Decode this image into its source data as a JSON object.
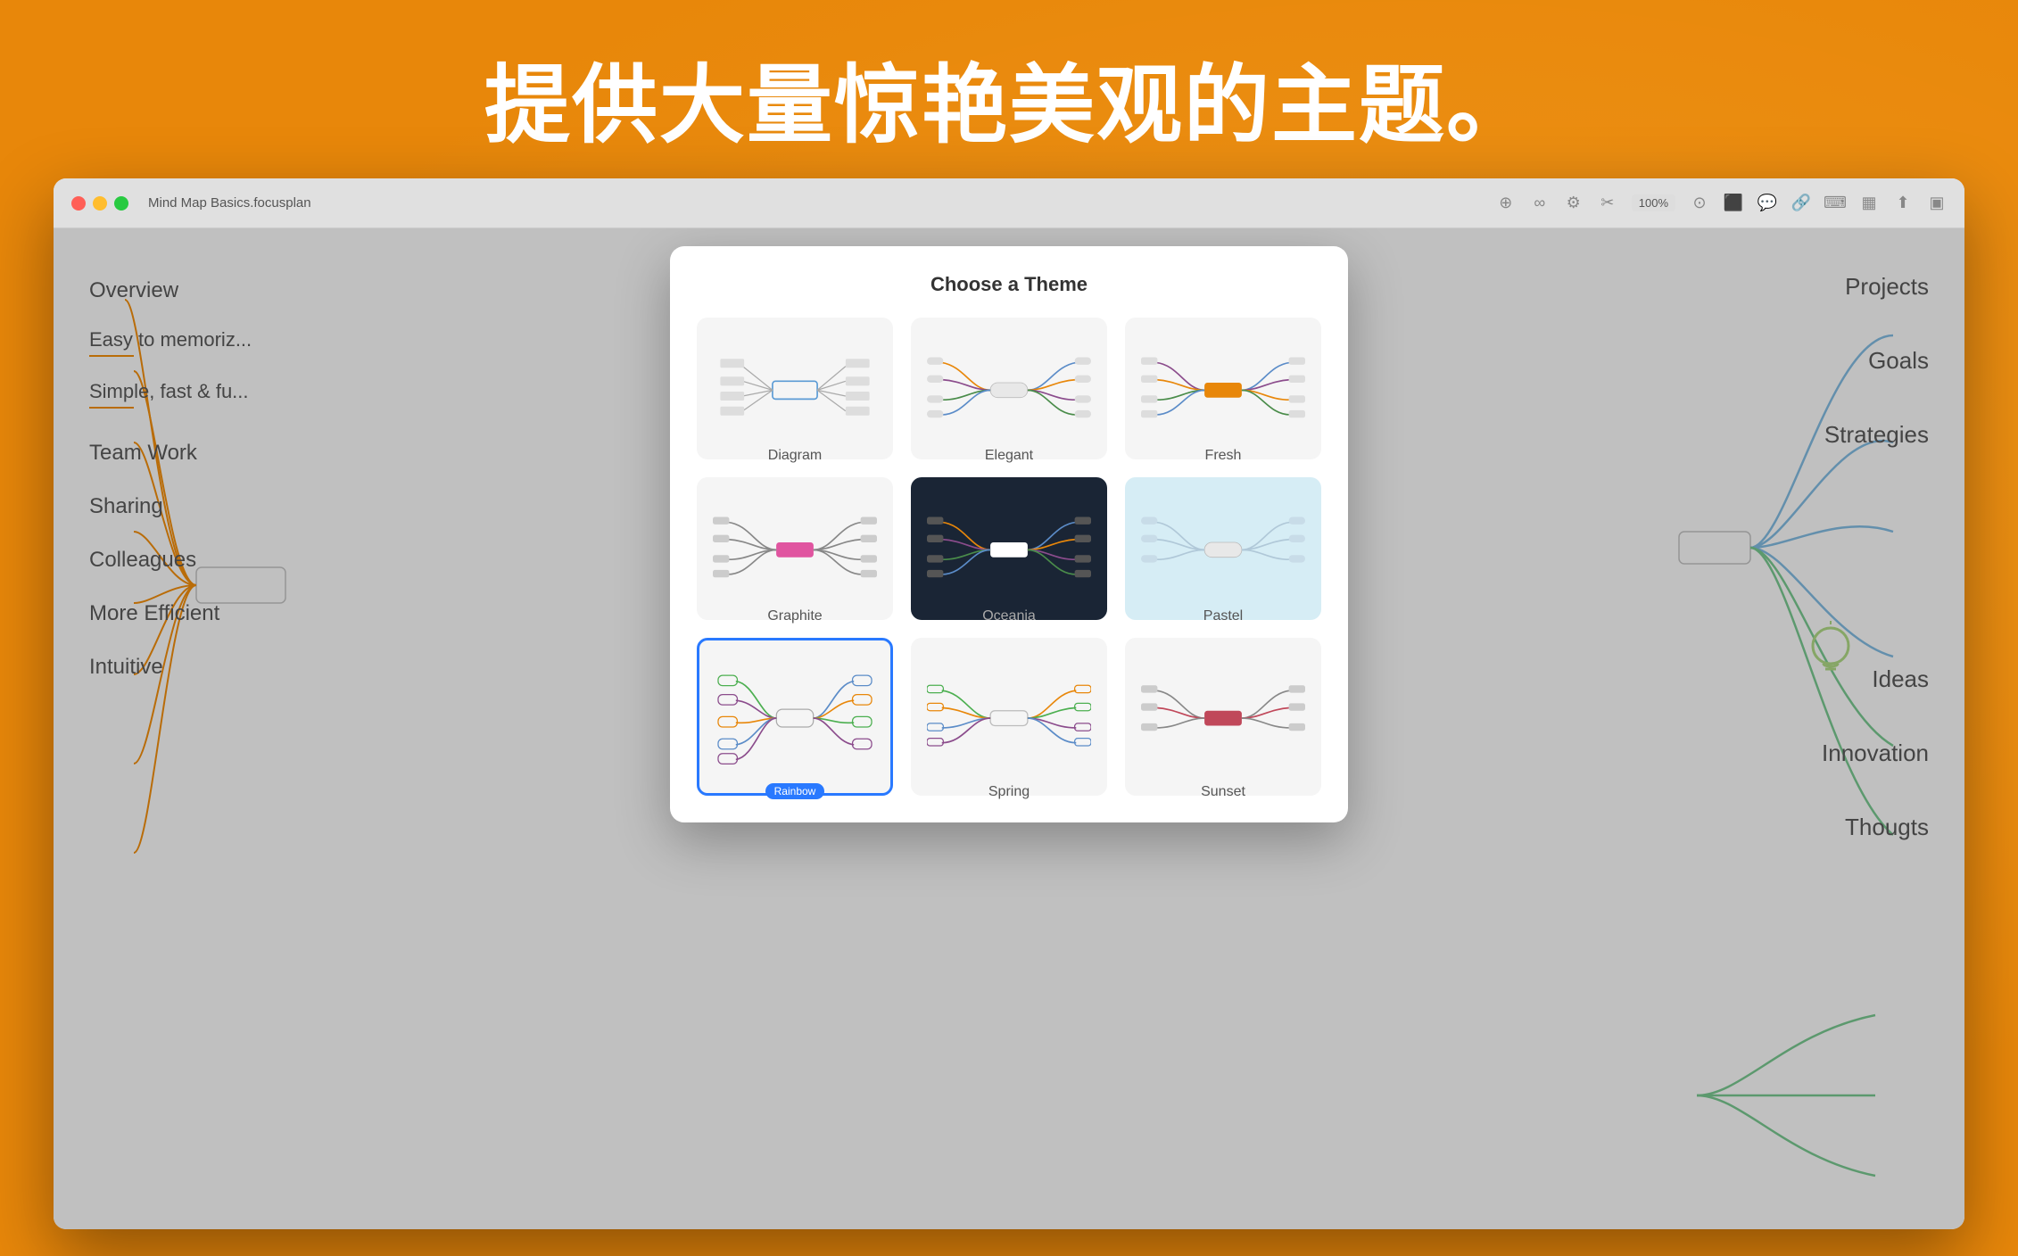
{
  "page": {
    "title": "提供大量惊艳美观的主题。",
    "background_color": "#E8870A"
  },
  "window": {
    "title": "Mind Map Basics.focusplan",
    "zoom": "100%"
  },
  "mindmap_left": {
    "nodes": [
      {
        "label": "Overview",
        "line": true
      },
      {
        "label": "Easy to memoriz...",
        "line": true
      },
      {
        "label": "Simple, fast & fu...",
        "line": true
      },
      {
        "label": "Team Work",
        "line": false
      },
      {
        "label": "Sharing",
        "line": false
      },
      {
        "label": "Colleagues",
        "line": false
      },
      {
        "label": "More Efficient",
        "line": false
      },
      {
        "label": "Intuitive",
        "line": false
      }
    ]
  },
  "mindmap_right": {
    "nodes": [
      "Projects",
      "Goals",
      "Strategies",
      "Ideas",
      "Innovation",
      "Thougts"
    ]
  },
  "modal": {
    "title": "Choose a Theme",
    "themes": [
      {
        "name": "Diagram",
        "style": "light",
        "selected": false
      },
      {
        "name": "Elegant",
        "style": "light",
        "selected": false
      },
      {
        "name": "Fresh",
        "style": "light",
        "selected": false
      },
      {
        "name": "Graphite",
        "style": "light",
        "selected": false
      },
      {
        "name": "Oceania",
        "style": "dark",
        "selected": false
      },
      {
        "name": "Pastel",
        "style": "lightblue",
        "selected": false
      },
      {
        "name": "Rainbow",
        "style": "light",
        "selected": true,
        "badge": "Rainbow"
      },
      {
        "name": "Spring",
        "style": "light",
        "selected": false
      },
      {
        "name": "Sunset",
        "style": "light",
        "selected": false
      }
    ]
  }
}
